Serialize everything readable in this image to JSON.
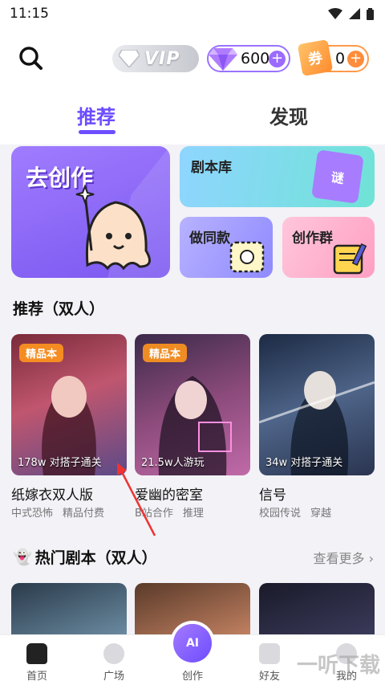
{
  "status_bar": {
    "time": "11:15"
  },
  "header": {
    "vip_label": "VIP",
    "gem_count": "600",
    "ticket_icon_text": "券",
    "ticket_count": "0",
    "tabs": [
      {
        "label": "推荐"
      },
      {
        "label": "发现"
      }
    ]
  },
  "feature_cards": {
    "create": "去创作",
    "library": "剧本库",
    "library_book": "谜",
    "same": "做同款",
    "group": "创作群"
  },
  "section_recommend": {
    "title": "推荐（双人）",
    "items": [
      {
        "tag": "精品本",
        "stat": "178w 对搭子通关",
        "title": "纸嫁衣双人版",
        "tags": [
          "中式恐怖",
          "精品付费"
        ]
      },
      {
        "tag": "精品本",
        "stat": "21.5w人游玩",
        "title": "爱幽的密室",
        "tags": [
          "B站合作",
          "推理"
        ]
      },
      {
        "tag": "",
        "stat": "34w 对搭子通关",
        "title": "信号",
        "tags": [
          "校园传说",
          "穿越"
        ]
      }
    ]
  },
  "section_hot": {
    "title": "热门剧本（双人）",
    "more": "查看更多"
  },
  "bottom_nav": {
    "items": [
      {
        "label": "首页"
      },
      {
        "label": "广场"
      },
      {
        "label": "创作",
        "icon_text": "AI"
      },
      {
        "label": "好友"
      },
      {
        "label": "我的"
      }
    ]
  },
  "watermark": "一听下载",
  "colors": {
    "accent": "#6d4dff",
    "gem": "#9b6bff",
    "ticket": "#ff8c3a"
  }
}
